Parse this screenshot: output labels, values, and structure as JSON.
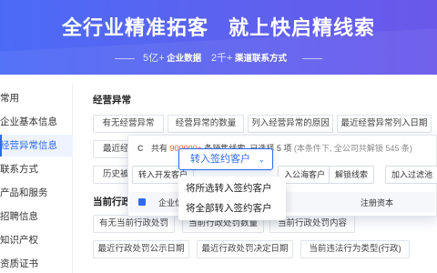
{
  "hero": {
    "title_left": "全行业精准拓客",
    "title_right": "就上快启精线索",
    "stat1_value": "5亿+",
    "stat1_label": "企业数据",
    "stat2_value": "2千+",
    "stat2_label": "渠道联系方式"
  },
  "sidebar": {
    "items": [
      {
        "label": "常用"
      },
      {
        "label": "企业基本信息"
      },
      {
        "label": "经营异常信息"
      },
      {
        "label": "联系方式"
      },
      {
        "label": "产品和服务"
      },
      {
        "label": "招聘信息"
      },
      {
        "label": "知识产权"
      },
      {
        "label": "资质证书"
      }
    ],
    "active_index": 2
  },
  "main": {
    "section1_title": "经营异常",
    "section1_chips": [
      "有无经营异常",
      "经营异常的数量",
      "列入经营异常的原因",
      "最近经营异常列入日期",
      "最近经",
      "历史被"
    ],
    "section2_title": "当前行政",
    "section2_chips": [
      "有无当前行政处罚",
      "当前行政处罚数量",
      "当前行政处罚内容",
      "最近行政处罚公示日期",
      "最近行政处罚决定日期",
      "当前违法行为类型(行政)"
    ]
  },
  "panel": {
    "refresh_icon": "C",
    "info_prefix": "共有",
    "info_count": "900000+",
    "info_suffix": "条销售线索, 已选择 5 项",
    "info_muted": "(本条件下, 全公司共解锁 545 条)",
    "buttons": [
      "转入开发客户",
      "入公海客户",
      "解锁线索",
      "加入过滤池"
    ],
    "table_col_a": "企业信",
    "table_col_b": "注册资本"
  },
  "dropdown": {
    "trigger_label": "转入签约客户",
    "chevron_icon": "chevron-down-icon",
    "options": [
      "将所选转入签约客户",
      "将全部转入签约客户"
    ]
  },
  "colors": {
    "accent": "#2f6bf0",
    "highlight": "#f0622d",
    "hero_start": "#4b6bf7",
    "hero_end": "#6a58ea"
  }
}
